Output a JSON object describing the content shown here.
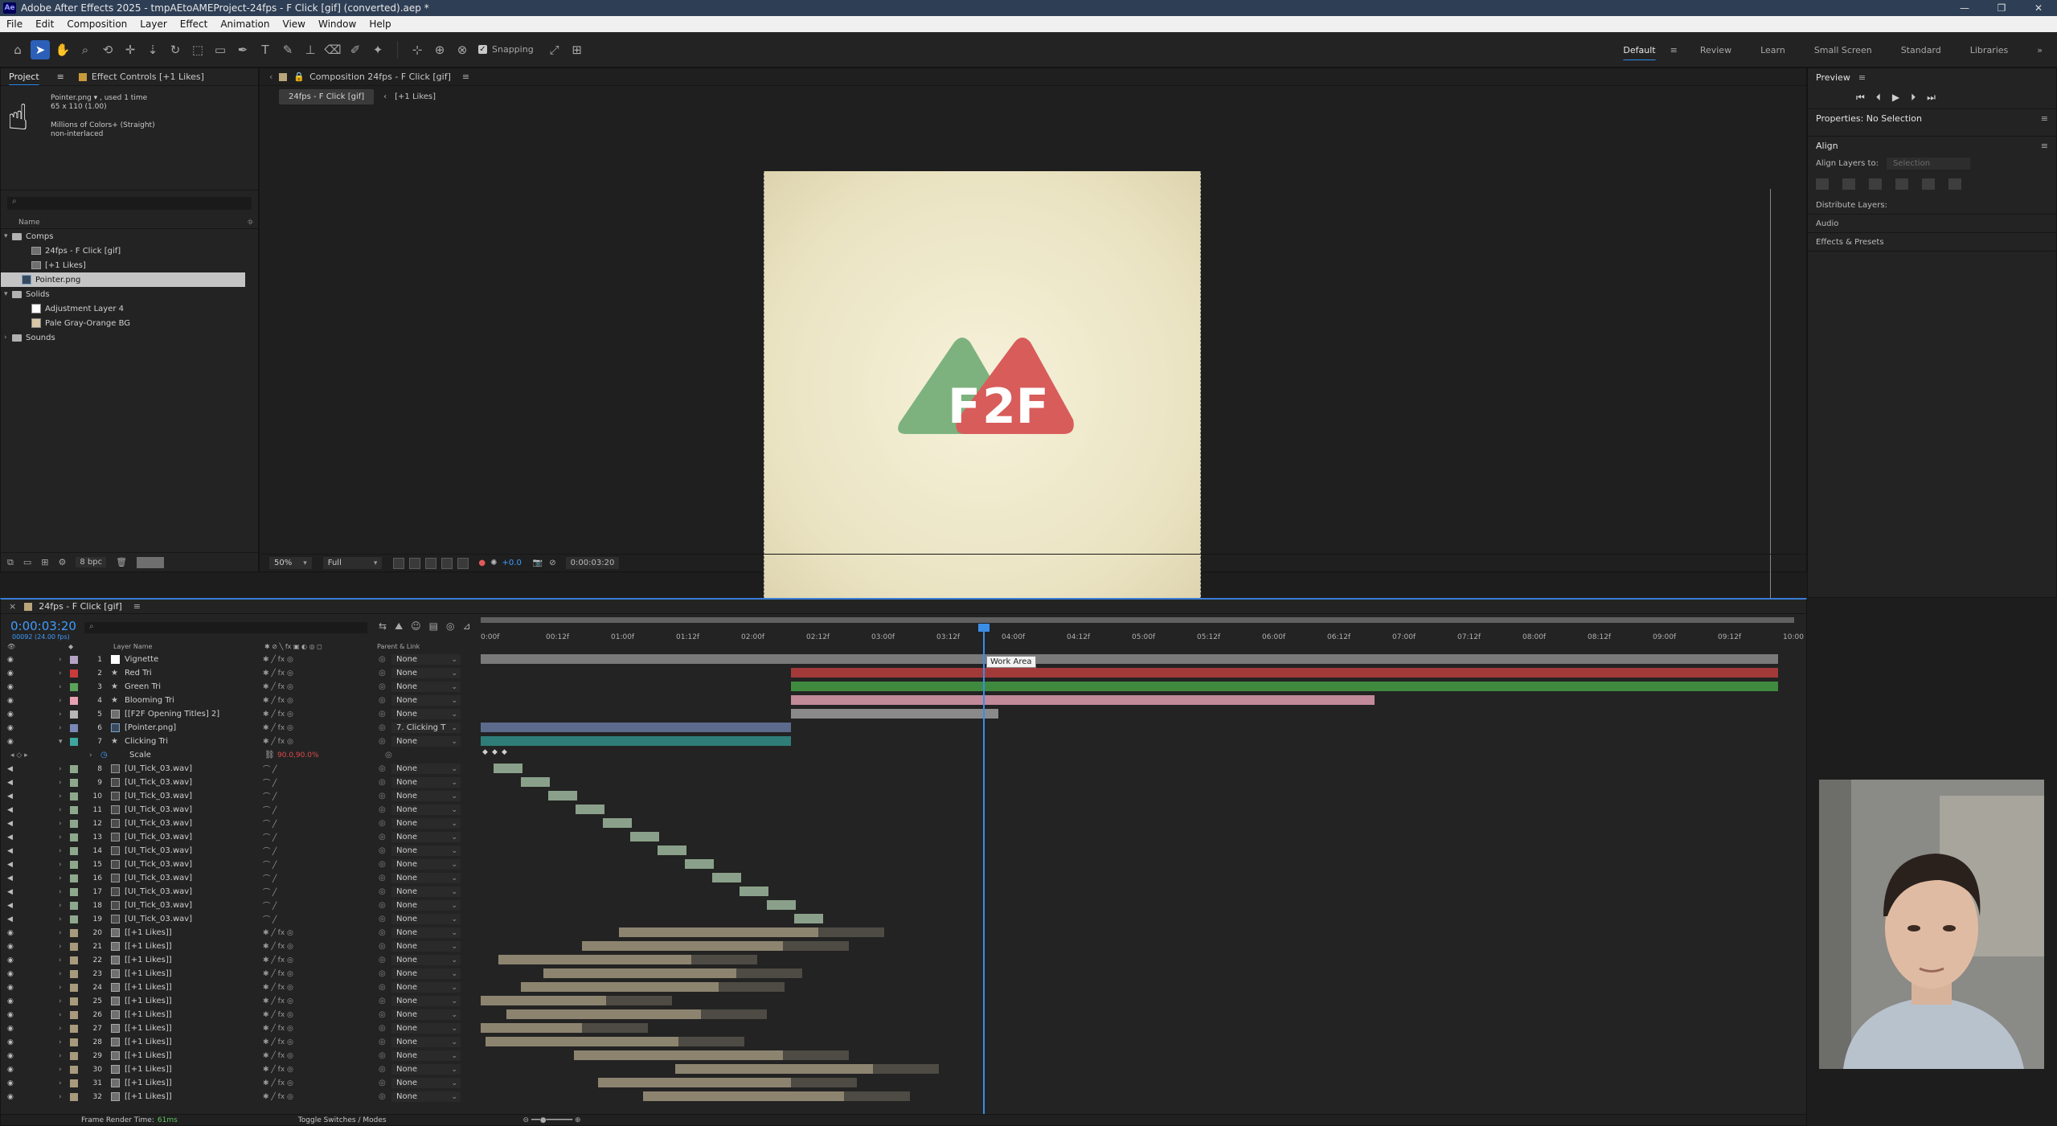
{
  "window": {
    "app_icon": "Ae",
    "title": "Adobe After Effects 2025 - tmpAEtoAMEProject-24fps - F Click [gif] (converted).aep *",
    "controls": [
      "—",
      "❐",
      "✕"
    ]
  },
  "menu": [
    "File",
    "Edit",
    "Composition",
    "Layer",
    "Effect",
    "Animation",
    "View",
    "Window",
    "Help"
  ],
  "toolbar": {
    "snapping_label": "Snapping",
    "workspaces": [
      "Default",
      "Review",
      "Learn",
      "Small Screen",
      "Standard",
      "Libraries"
    ],
    "active_workspace": "Default"
  },
  "project": {
    "tabs": [
      "Project",
      "Effect Controls [+1 Likes]"
    ],
    "info_name": "Pointer.png ▾ , used 1 time",
    "info_dims": "65 x 110 (1.00)",
    "info_colors": "Millions of Colors+ (Straight)",
    "info_interlace": "non-interlaced",
    "search_placeholder": "⌕",
    "col_name": "Name",
    "items": [
      {
        "label": "Comps",
        "type": "folder",
        "indent": 0,
        "open": "▾"
      },
      {
        "label": "24fps - F Click [gif]",
        "type": "comp",
        "indent": 2,
        "open": ""
      },
      {
        "label": "[+1 Likes]",
        "type": "comp",
        "indent": 2,
        "open": ""
      },
      {
        "label": "Pointer.png",
        "type": "image",
        "indent": 1,
        "open": "",
        "selected": true
      },
      {
        "label": "Solids",
        "type": "folder",
        "indent": 0,
        "open": "▾"
      },
      {
        "label": "Adjustment Layer 4",
        "type": "solid-white",
        "indent": 2,
        "open": ""
      },
      {
        "label": "Pale Gray-Orange BG",
        "type": "solid-beige",
        "indent": 2,
        "open": ""
      },
      {
        "label": "Sounds",
        "type": "folder",
        "indent": 0,
        "open": "›"
      }
    ],
    "bpc": "8 bpc"
  },
  "composition": {
    "tab_label": "Composition 24fps - F Click [gif]",
    "crumb_main": "24fps - F Click [gif]",
    "crumb_sub": "[+1 Likes]",
    "logo_text_left": "F",
    "logo_text_right": "2F",
    "zoom": "50%",
    "resolution": "Full",
    "exposure": "+0.0",
    "timecode": "0:00:03:20",
    "colors": {
      "green": "#7db27e",
      "red": "#d85c5a",
      "bg": "#efe9cc"
    }
  },
  "right_panel": {
    "preview_title": "Preview",
    "preview_controls": [
      "⏮",
      "⏴",
      "▶",
      "⏵",
      "⏭"
    ],
    "properties_title": "Properties: No Selection",
    "align_title": "Align",
    "align_layers_to_label": "Align Layers to:",
    "align_layers_to_value": "Selection",
    "distribute_label": "Distribute Layers:",
    "audio_label": "Audio",
    "effects_label": "Effects & Presets"
  },
  "timeline": {
    "tab_label": "24fps - F Click [gif]",
    "timecode": "0:00:03:20",
    "timecode_sub": "00092 (24.00 fps)",
    "search_placeholder": "⌕",
    "col_layer_name": "Layer Name",
    "col_parent": "Parent & Link",
    "ruler_labels": [
      "0:00f",
      "00:12f",
      "01:00f",
      "01:12f",
      "02:00f",
      "02:12f",
      "03:00f",
      "03:12f",
      "04:00f",
      "04:12f",
      "05:00f",
      "05:12f",
      "06:00f",
      "06:12f",
      "07:00f",
      "07:12f",
      "08:00f",
      "08:12f",
      "09:00f",
      "09:12f",
      "10:00"
    ],
    "work_area_tip": "Work Area",
    "scale_label": "Scale",
    "scale_value": "90.0,90.0%",
    "layers": [
      {
        "num": "1",
        "name": "Vignette",
        "color": "#b4a3c4",
        "icon": "white",
        "parent": "None"
      },
      {
        "num": "2",
        "name": "Red Tri",
        "color": "#c83c3c",
        "icon": "star",
        "parent": "None"
      },
      {
        "num": "3",
        "name": "Green Tri",
        "color": "#5ca25c",
        "icon": "star",
        "parent": "None"
      },
      {
        "num": "4",
        "name": "Blooming Tri",
        "color": "#e8a0b0",
        "icon": "star",
        "parent": "None"
      },
      {
        "num": "5",
        "name": "[[F2F Opening Titles] 2]",
        "color": "#b7b7b7",
        "icon": "comp",
        "parent": "None"
      },
      {
        "num": "6",
        "name": "[Pointer.png]",
        "color": "#7a88b8",
        "icon": "image",
        "parent": "7. Clicking T"
      },
      {
        "num": "7",
        "name": "Clicking Tri",
        "color": "#3fa6a0",
        "icon": "star",
        "parent": "None"
      },
      {
        "num": "8",
        "name": "[UI_Tick_03.wav]",
        "color": "#8ea88e",
        "icon": "audio",
        "parent": "None"
      },
      {
        "num": "9",
        "name": "[UI_Tick_03.wav]",
        "color": "#8ea88e",
        "icon": "audio",
        "parent": "None"
      },
      {
        "num": "10",
        "name": "[UI_Tick_03.wav]",
        "color": "#8ea88e",
        "icon": "audio",
        "parent": "None"
      },
      {
        "num": "11",
        "name": "[UI_Tick_03.wav]",
        "color": "#8ea88e",
        "icon": "audio",
        "parent": "None"
      },
      {
        "num": "12",
        "name": "[UI_Tick_03.wav]",
        "color": "#8ea88e",
        "icon": "audio",
        "parent": "None"
      },
      {
        "num": "13",
        "name": "[UI_Tick_03.wav]",
        "color": "#8ea88e",
        "icon": "audio",
        "parent": "None"
      },
      {
        "num": "14",
        "name": "[UI_Tick_03.wav]",
        "color": "#8ea88e",
        "icon": "audio",
        "parent": "None"
      },
      {
        "num": "15",
        "name": "[UI_Tick_03.wav]",
        "color": "#8ea88e",
        "icon": "audio",
        "parent": "None"
      },
      {
        "num": "16",
        "name": "[UI_Tick_03.wav]",
        "color": "#8ea88e",
        "icon": "audio",
        "parent": "None"
      },
      {
        "num": "17",
        "name": "[UI_Tick_03.wav]",
        "color": "#8ea88e",
        "icon": "audio",
        "parent": "None"
      },
      {
        "num": "18",
        "name": "[UI_Tick_03.wav]",
        "color": "#8ea88e",
        "icon": "audio",
        "parent": "None"
      },
      {
        "num": "19",
        "name": "[UI_Tick_03.wav]",
        "color": "#8ea88e",
        "icon": "audio",
        "parent": "None"
      },
      {
        "num": "20",
        "name": "[[+1 Likes]]",
        "color": "#a89a7c",
        "icon": "comp",
        "parent": "None"
      },
      {
        "num": "21",
        "name": "[[+1 Likes]]",
        "color": "#a89a7c",
        "icon": "comp",
        "parent": "None"
      },
      {
        "num": "22",
        "name": "[[+1 Likes]]",
        "color": "#a89a7c",
        "icon": "comp",
        "parent": "None"
      },
      {
        "num": "23",
        "name": "[[+1 Likes]]",
        "color": "#a89a7c",
        "icon": "comp",
        "parent": "None"
      },
      {
        "num": "24",
        "name": "[[+1 Likes]]",
        "color": "#a89a7c",
        "icon": "comp",
        "parent": "None"
      },
      {
        "num": "25",
        "name": "[[+1 Likes]]",
        "color": "#a89a7c",
        "icon": "comp",
        "parent": "None"
      },
      {
        "num": "26",
        "name": "[[+1 Likes]]",
        "color": "#a89a7c",
        "icon": "comp",
        "parent": "None"
      },
      {
        "num": "27",
        "name": "[[+1 Likes]]",
        "color": "#a89a7c",
        "icon": "comp",
        "parent": "None"
      },
      {
        "num": "28",
        "name": "[[+1 Likes]]",
        "color": "#a89a7c",
        "icon": "comp",
        "parent": "None"
      },
      {
        "num": "29",
        "name": "[[+1 Likes]]",
        "color": "#a89a7c",
        "icon": "comp",
        "parent": "None"
      },
      {
        "num": "30",
        "name": "[[+1 Likes]]",
        "color": "#a89a7c",
        "icon": "comp",
        "parent": "None"
      },
      {
        "num": "31",
        "name": "[[+1 Likes]]",
        "color": "#a89a7c",
        "icon": "comp",
        "parent": "None"
      },
      {
        "num": "32",
        "name": "[[+1 Likes]]",
        "color": "#a89a7c",
        "icon": "comp",
        "parent": "None"
      }
    ],
    "footer_render_label": "Frame Render Time:",
    "footer_render_value": "61ms",
    "footer_toggle": "Toggle Switches / Modes"
  }
}
